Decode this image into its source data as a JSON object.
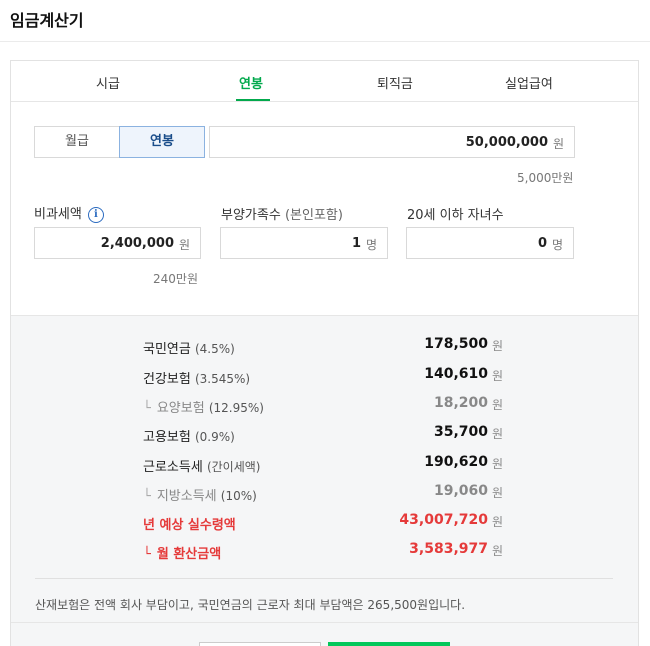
{
  "header": {
    "title": "임금계산기"
  },
  "tabs": [
    {
      "label": "시급"
    },
    {
      "label": "연봉"
    },
    {
      "label": "퇴직금"
    },
    {
      "label": "실업급여"
    }
  ],
  "pay_type": {
    "monthly": "월급",
    "annual": "연봉"
  },
  "salary": {
    "value": "50,000,000",
    "unit": "원",
    "helper": "5,000만원"
  },
  "nontaxable": {
    "label": "비과세액",
    "value": "2,400,000",
    "unit": "원",
    "helper": "240만원"
  },
  "dependents": {
    "label": "부양가족수",
    "label_sub": "(본인포함)",
    "value": "1",
    "unit": "명"
  },
  "children": {
    "label": "20세 이하 자녀수",
    "value": "0",
    "unit": "명"
  },
  "results": [
    {
      "name": "국민연금",
      "pct": "(4.5%)",
      "amount": "178,500",
      "unit": "원"
    },
    {
      "name": "건강보험",
      "pct": "(3.545%)",
      "amount": "140,610",
      "unit": "원"
    },
    {
      "branch": "└",
      "name": "요양보험",
      "pct": "(12.95%)",
      "amount": "18,200",
      "unit": "원"
    },
    {
      "name": "고용보험",
      "pct": "(0.9%)",
      "amount": "35,700",
      "unit": "원"
    },
    {
      "name": "근로소득세",
      "pct": "(간이세액)",
      "amount": "190,620",
      "unit": "원"
    },
    {
      "branch": "└",
      "name": "지방소득세",
      "pct": "(10%)",
      "amount": "19,060",
      "unit": "원"
    },
    {
      "name": "년 예상 실수령액",
      "amount": "43,007,720",
      "unit": "원"
    },
    {
      "branch": "└",
      "name": "월 환산금액",
      "amount": "3,583,977",
      "unit": "원"
    }
  ],
  "note": "산재보험은 전액 회사 부담이고, 국민연금의 근로자 최대 부담액은 265,500원입니다.",
  "colors": {
    "accent": "#03a94d",
    "button": "#03c75a",
    "highlight": "#e53a3a",
    "selected_border": "#8bb2e0"
  },
  "icons": {
    "info": "info-circle-icon"
  }
}
